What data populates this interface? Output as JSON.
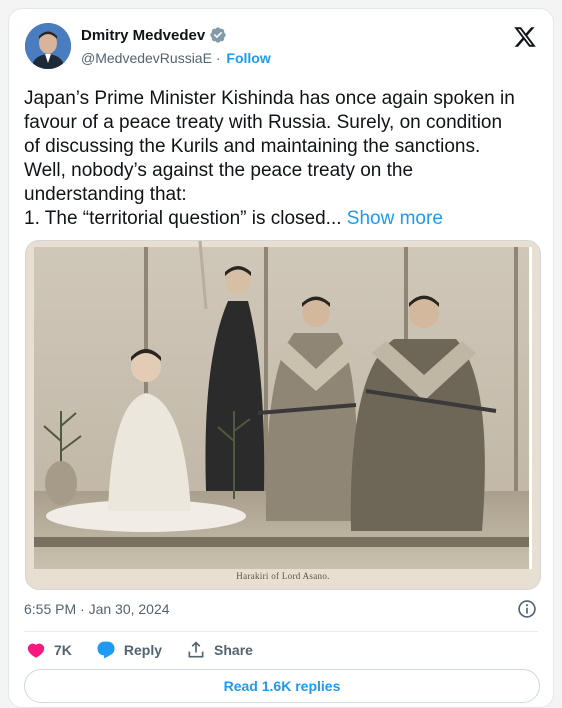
{
  "author": {
    "display_name": "Dmitry Medvedev",
    "handle": "@MedvedevRussiaE",
    "separator": "·",
    "follow_label": "Follow",
    "verified_color": "#829aab"
  },
  "tweet": {
    "lines": [
      "Japan’s Prime Minister Kishinda has once again spoken in",
      "favour of a peace treaty with Russia. Surely, on condition",
      "of discussing the Kurils and maintaining the sanctions.",
      "Well, nobody’s against the peace treaty on the",
      "understanding that:"
    ],
    "last_line": "1. The “territorial question” is closed...",
    "show_more_label": "Show more"
  },
  "media": {
    "caption": "Harakiri of Lord Asano."
  },
  "meta": {
    "timestamp": "6:55 PM · Jan 30, 2024"
  },
  "actions": {
    "likes": "7K",
    "reply_label": "Reply",
    "share_label": "Share"
  },
  "footer": {
    "read_replies_label": "Read 1.6K replies"
  },
  "colors": {
    "accent": "#1d9bf0",
    "like": "#f91880",
    "text_secondary": "#536471"
  }
}
